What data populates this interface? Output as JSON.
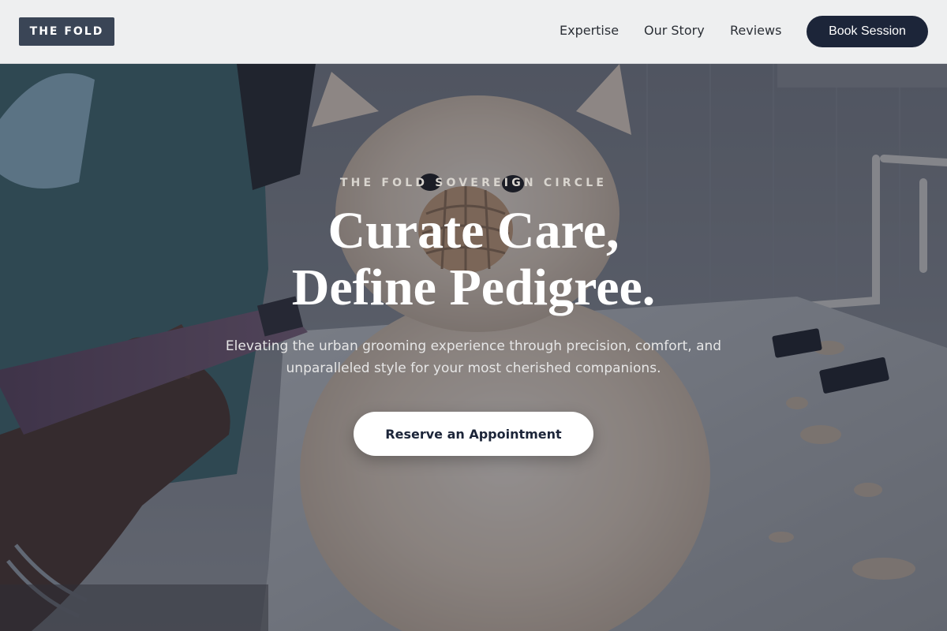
{
  "navbar": {
    "logo_text": "THE FOLD",
    "links": [
      {
        "label": "Expertise"
      },
      {
        "label": "Our Story"
      },
      {
        "label": "Reviews"
      }
    ],
    "cta_label": "Book Session"
  },
  "hero": {
    "eyebrow": "THE FOLD SOVEREIGN CIRCLE",
    "headline_line1": "Curate Care,",
    "headline_line2": "Define Pedigree.",
    "subtext": "Elevating the urban grooming experience through precision, comfort, and unparalleled style for your most cherished companions.",
    "cta_label": "Reserve an Appointment",
    "background_image": "groomer-clipping-pomeranian-photo"
  },
  "colors": {
    "navbar_bg": "#eeeff0",
    "logo_bg": "#3a4556",
    "primary_dark": "#1c2539",
    "hero_overlay": "#1c263a",
    "white": "#ffffff"
  }
}
